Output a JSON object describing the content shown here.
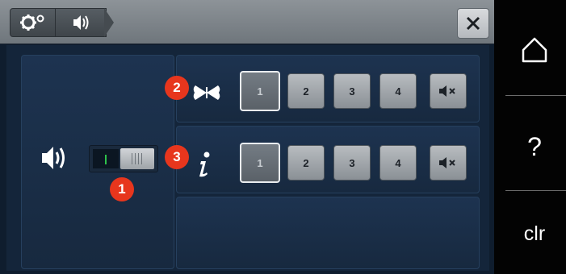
{
  "breadcrumb": {
    "items": [
      {
        "icon": "settings-icon"
      },
      {
        "icon": "speaker-icon"
      }
    ]
  },
  "header": {
    "close_icon": "close-icon"
  },
  "sound": {
    "toggle_on": true,
    "speaker_icon": "speaker-icon"
  },
  "rows": [
    {
      "badge": "2",
      "icon": "butterfly-icon",
      "selected": "1",
      "buttons": [
        "1",
        "2",
        "3",
        "4"
      ],
      "mute_icon": "mute-icon"
    },
    {
      "badge": "3",
      "icon": "info-icon",
      "selected": "1",
      "buttons": [
        "1",
        "2",
        "3",
        "4"
      ],
      "mute_icon": "mute-icon"
    }
  ],
  "toggle_badge": "1",
  "sidebar": {
    "home_icon": "home-icon",
    "help_label": "?",
    "clr_label": "clr"
  },
  "colors": {
    "badge": "#e7361d",
    "panel": "#1d3350",
    "toggle_on_mark": "#2ec24b"
  }
}
